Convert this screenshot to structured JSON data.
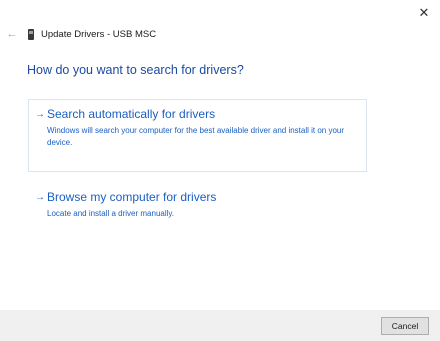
{
  "window": {
    "title": "Update Drivers - USB MSC",
    "close_glyph": "✕",
    "back_glyph": "←",
    "device_icon": "usb-drive-icon"
  },
  "heading": "How do you want to search for drivers?",
  "options": [
    {
      "arrow": "→",
      "title": "Search automatically for drivers",
      "description": "Windows will search your computer for the best available driver and install it on your device."
    },
    {
      "arrow": "→",
      "title": "Browse my computer for drivers",
      "description": "Locate and install a driver manually."
    }
  ],
  "footer": {
    "cancel_label": "Cancel"
  },
  "colors": {
    "accent": "#1b5fc1",
    "heading": "#1b4aa0",
    "footer_bg": "#f0f0f0"
  }
}
